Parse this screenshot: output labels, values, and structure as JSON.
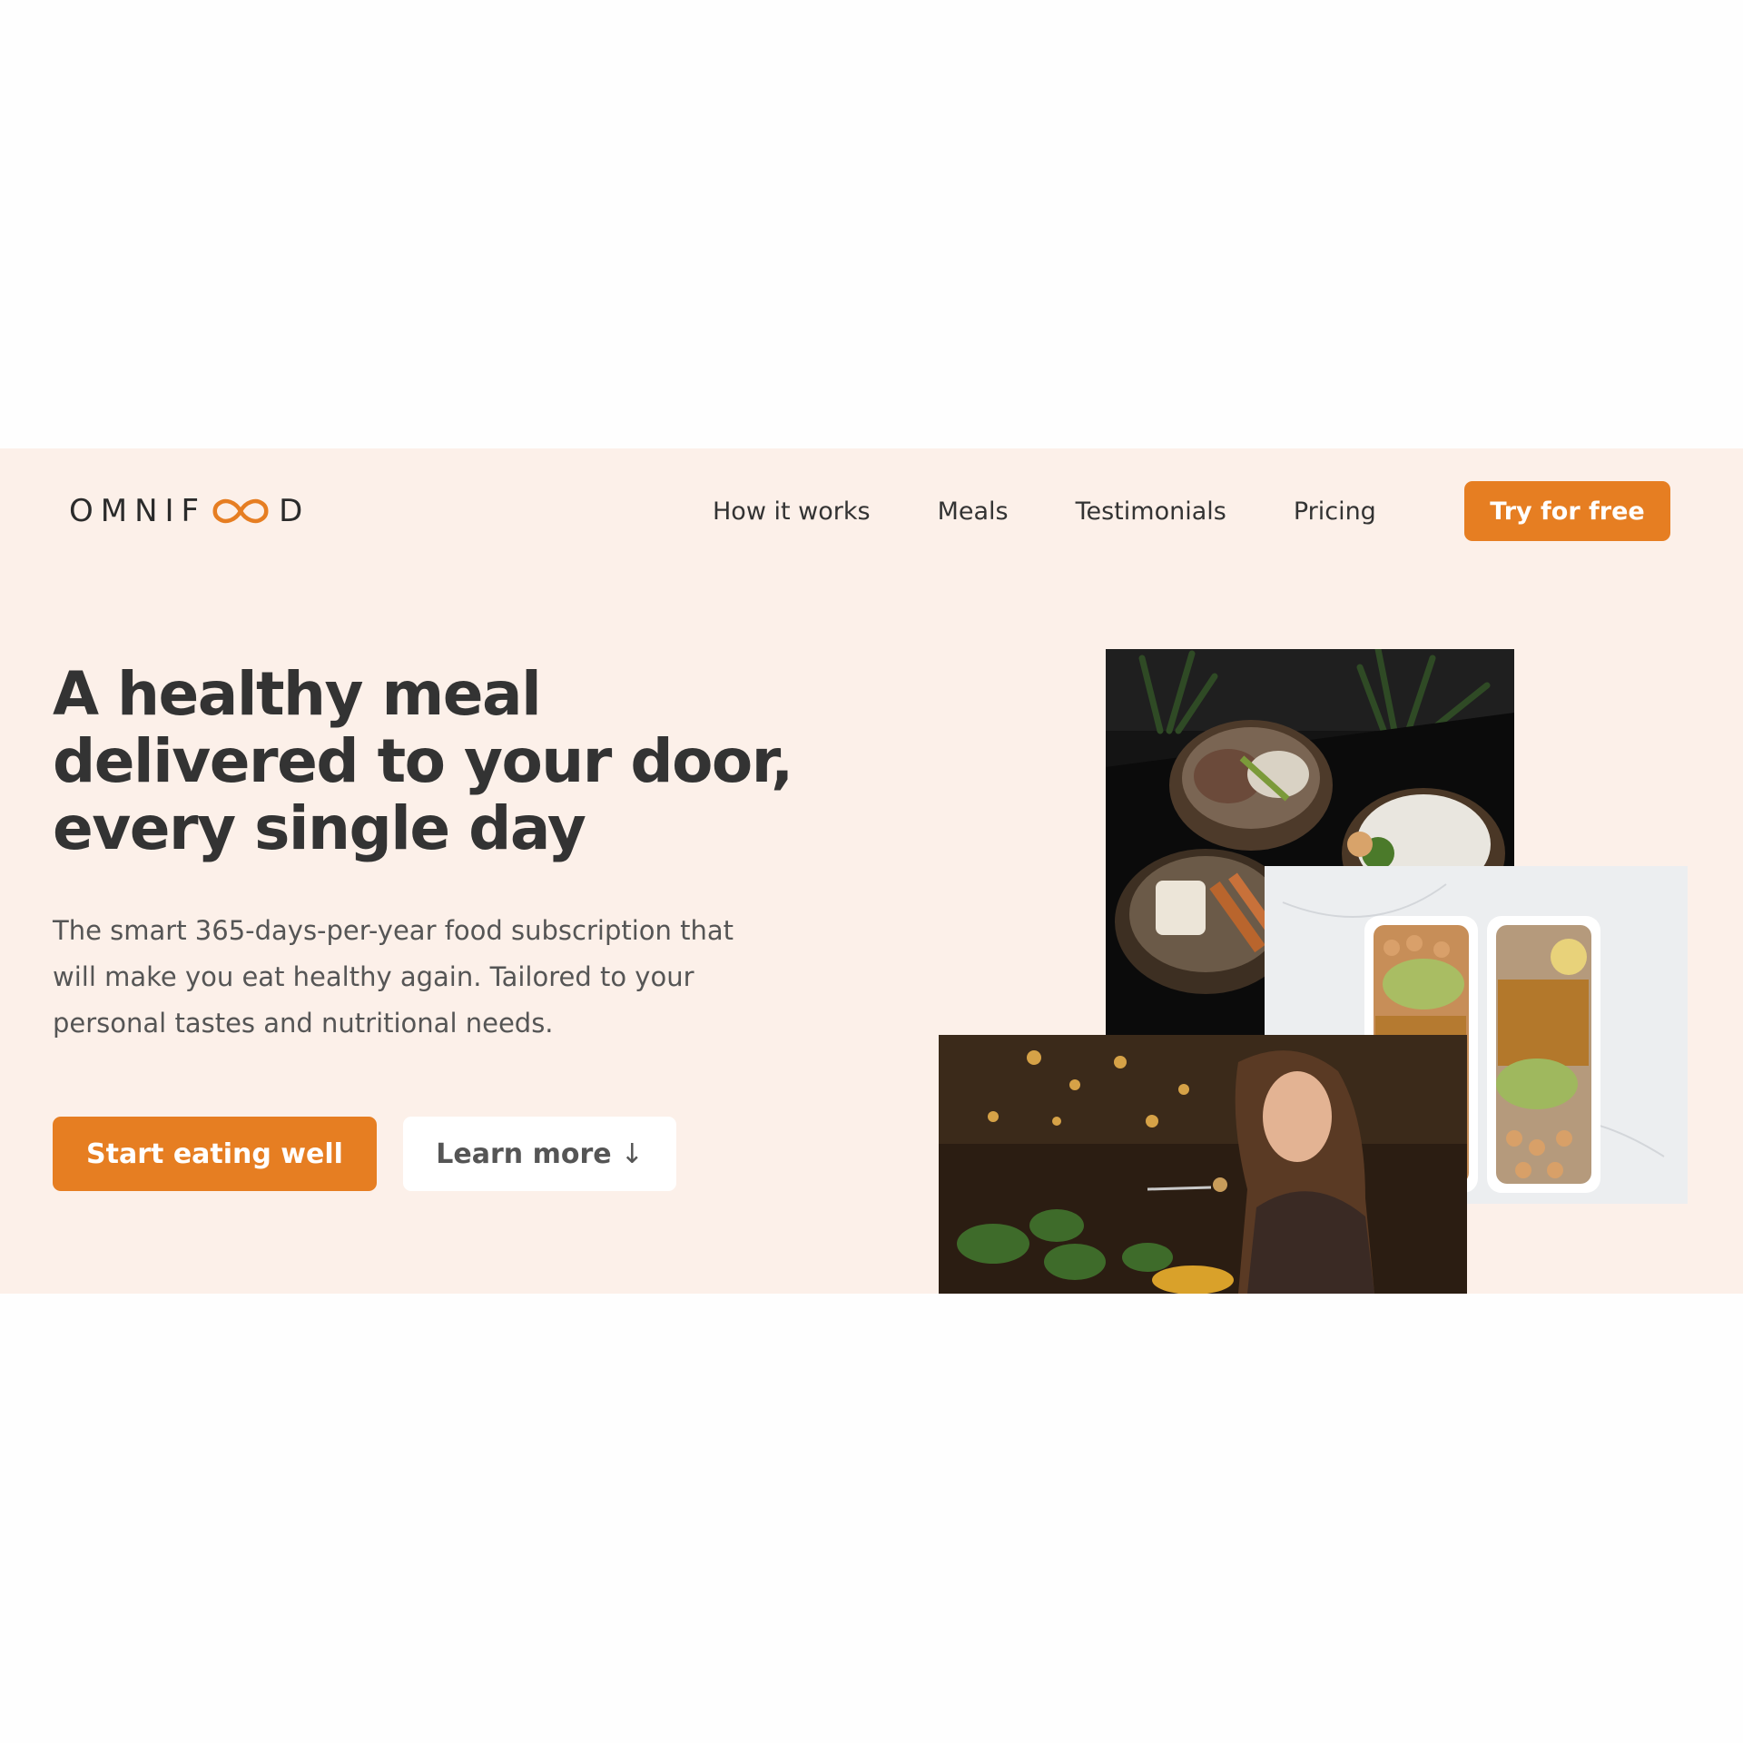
{
  "header": {
    "logo": {
      "text_before": "OMNIF",
      "text_after": "D",
      "icon": "infinity-icon",
      "accent": "#e67e22"
    },
    "nav": [
      {
        "label": "How it works"
      },
      {
        "label": "Meals"
      },
      {
        "label": "Testimonials"
      },
      {
        "label": "Pricing"
      }
    ],
    "cta_label": "Try for free"
  },
  "hero": {
    "title": "A healthy meal delivered to your door, every single day",
    "description": "The smart 365-days-per-year food subscription that will make you eat healthy again. Tailored to your personal tastes and nutritional needs.",
    "primary_button": "Start eating well",
    "secondary_button": "Learn more",
    "secondary_button_icon": "arrow-down-icon",
    "images": [
      {
        "name": "bowls-photo"
      },
      {
        "name": "meal-prep-boxes-photo"
      },
      {
        "name": "woman-eating-photo"
      }
    ]
  },
  "colors": {
    "accent": "#e67e22",
    "hero_background": "#fcf0e9",
    "page_background": "#fefefe",
    "text_primary": "#333333",
    "text_secondary": "#555555"
  }
}
